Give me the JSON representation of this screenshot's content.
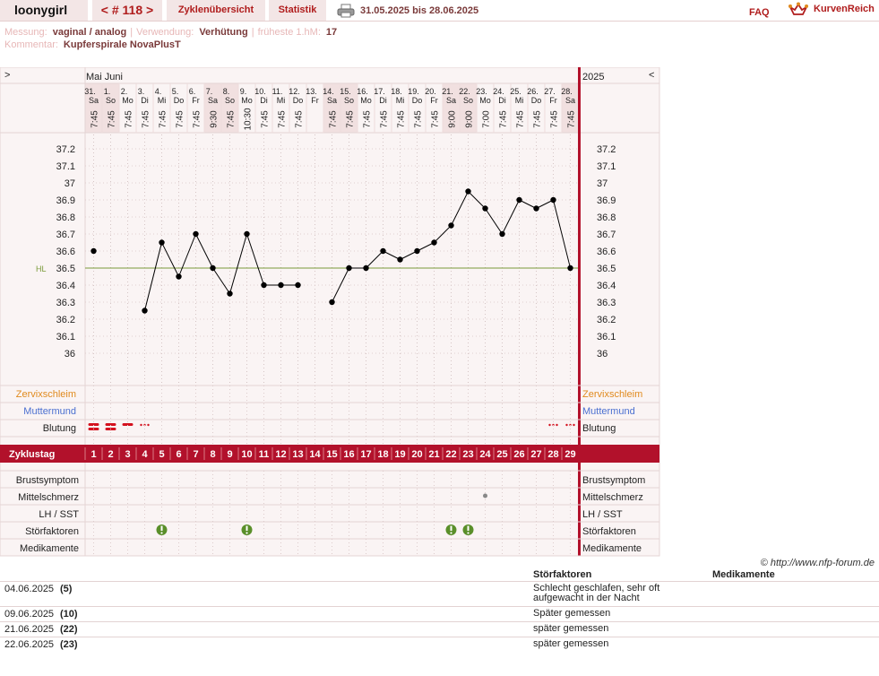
{
  "header": {
    "user": "loonygirl",
    "cycle_nav": "< # 118 >",
    "tab_overview": "Zyklenübersicht",
    "tab_stats": "Statistik",
    "date_range": "31.05.2025 bis 28.06.2025",
    "faq": "FAQ",
    "brand": "KurvenReich"
  },
  "meta": {
    "messung_label": "Messung:",
    "messung_value": "vaginal / analog",
    "verwendung_label": "Verwendung:",
    "verwendung_value": "Verhütung",
    "hm_label": "früheste 1.hM:",
    "hm_value": "17",
    "kommentar_label": "Kommentar:",
    "kommentar_value": "Kupferspirale NovaPlusT"
  },
  "chart_data": {
    "type": "line",
    "nav_left": ">",
    "nav_right": "<",
    "months": "Mai Juni",
    "year": "2025",
    "dates": [
      "31.",
      "1.",
      "2.",
      "3.",
      "4.",
      "5.",
      "6.",
      "7.",
      "8.",
      "9.",
      "10.",
      "11.",
      "12.",
      "13.",
      "14.",
      "15.",
      "16.",
      "17.",
      "18.",
      "19.",
      "20.",
      "21.",
      "22.",
      "23.",
      "24.",
      "25.",
      "26.",
      "27.",
      "28."
    ],
    "weekdays": [
      "Sa",
      "So",
      "Mo",
      "Di",
      "Mi",
      "Do",
      "Fr",
      "Sa",
      "So",
      "Mo",
      "Di",
      "Mi",
      "Do",
      "Fr",
      "Sa",
      "So",
      "Mo",
      "Di",
      "Mi",
      "Do",
      "Fr",
      "Sa",
      "So",
      "Mo",
      "Di",
      "Mi",
      "Do",
      "Fr",
      "Sa"
    ],
    "weekend": [
      true,
      true,
      false,
      false,
      false,
      false,
      false,
      true,
      true,
      false,
      false,
      false,
      false,
      false,
      true,
      true,
      false,
      false,
      false,
      false,
      false,
      true,
      true,
      false,
      false,
      false,
      false,
      false,
      true
    ],
    "times": [
      "7:45",
      "7:45",
      "7:45",
      "7:45",
      "7:45",
      "7:45",
      "7:45",
      "9:30",
      "7:45",
      "10:30",
      "7:45",
      "7:45",
      "7:45",
      "",
      "7:45",
      "7:45",
      "7:45",
      "7:45",
      "7:45",
      "7:45",
      "7:45",
      "9:00",
      "9:00",
      "7:00",
      "7:45",
      "7:45",
      "7:45",
      "7:45",
      "7:45"
    ],
    "cycle_days": [
      1,
      2,
      3,
      4,
      5,
      6,
      7,
      8,
      9,
      10,
      11,
      12,
      13,
      14,
      15,
      16,
      17,
      18,
      19,
      20,
      21,
      22,
      23,
      24,
      25,
      26,
      27,
      28,
      29
    ],
    "temperatures": [
      36.6,
      null,
      null,
      36.25,
      36.65,
      36.45,
      36.7,
      36.5,
      36.35,
      36.7,
      36.4,
      36.4,
      36.4,
      null,
      36.3,
      36.5,
      36.5,
      36.6,
      36.55,
      36.6,
      36.65,
      36.75,
      36.95,
      36.85,
      36.7,
      36.9,
      36.85,
      36.9,
      36.5
    ],
    "hl_label": "HL",
    "hl_value": 36.5,
    "y_ticks": [
      "37.2",
      "37.1",
      "37",
      "36.9",
      "36.8",
      "36.7",
      "36.6",
      "36.5",
      "36.4",
      "36.3",
      "36.2",
      "36.1",
      "36"
    ],
    "ylim": [
      36.0,
      37.2
    ],
    "rows": {
      "zervix": "Zervixschleim",
      "muttermund": "Muttermund",
      "blutung": "Blutung",
      "zyklustag": "Zyklustag",
      "brust": "Brustsymptom",
      "mittel": "Mittelschmerz",
      "lh": "LH / SST",
      "stoer": "Störfaktoren",
      "medi": "Medikamente"
    },
    "bleeding": [
      "heavy",
      "heavy",
      "medium",
      "spotting",
      null,
      null,
      null,
      null,
      null,
      null,
      null,
      null,
      null,
      null,
      null,
      null,
      null,
      null,
      null,
      null,
      null,
      null,
      null,
      null,
      null,
      null,
      null,
      "spotting",
      "spotting"
    ],
    "mittelschmerz_days": [
      24
    ],
    "stoer_days": [
      5,
      10,
      22,
      23
    ],
    "colors": {
      "accent": "#b2112b",
      "line": "#000000",
      "hl": "#7a9a3a",
      "zervix": "#e08a1e",
      "muttermund": "#4a6fd0",
      "stoer": "#5a8f2a"
    }
  },
  "notes": {
    "credit": "© http://www.nfp-forum.de",
    "col_stoer": "Störfaktoren",
    "col_medi": "Medikamente",
    "rows": [
      {
        "date": "04.06.2025",
        "day": "(5)",
        "stoer": "Schlecht geschlafen, sehr oft aufgewacht in der Nacht"
      },
      {
        "date": "09.06.2025",
        "day": "(10)",
        "stoer": "Später gemessen"
      },
      {
        "date": "21.06.2025",
        "day": "(22)",
        "stoer": "später gemessen"
      },
      {
        "date": "22.06.2025",
        "day": "(23)",
        "stoer": "später gemessen"
      }
    ]
  }
}
